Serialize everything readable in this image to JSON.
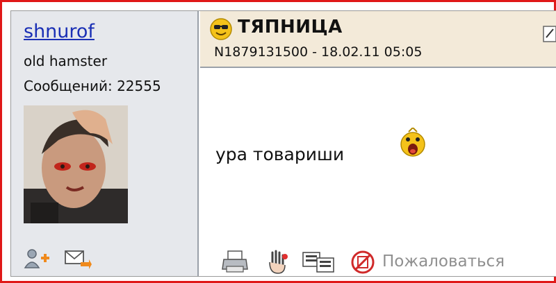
{
  "author": {
    "username": "shnurof",
    "rank": "old hamster",
    "messages_label": "Сообщений: 22555"
  },
  "post": {
    "title": "ТЯПНИЦА",
    "meta": "N1879131500 - 18.02.11 05:05",
    "message": "ура товариши"
  },
  "actions": {
    "report_label": "Пожаловаться"
  },
  "icons": {
    "title_smiley": "cool-smiley-icon",
    "post_smiley": "screaming-smiley-icon",
    "edit": "edit-icon",
    "add_friend": "add-friend-icon",
    "send_message": "send-message-icon",
    "print": "print-icon",
    "gesture": "hand-gesture-icon",
    "reply": "reply-icon",
    "report": "report-icon"
  },
  "colors": {
    "frame_border": "#e01818",
    "username_link": "#1a2fb5",
    "sidebar_bg": "#e6e8ec",
    "header_bg": "#f3ead9",
    "report_text": "#8f8f8f"
  }
}
